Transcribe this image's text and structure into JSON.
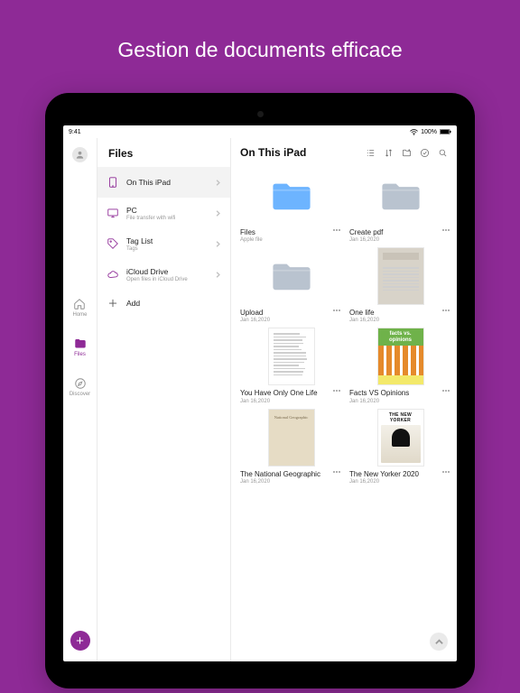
{
  "hero": "Gestion de documents efficace",
  "status": {
    "time": "9:41",
    "battery": "100%"
  },
  "rail": {
    "home": "Home",
    "files": "Files",
    "discover": "Discover"
  },
  "side": {
    "title": "Files",
    "locations": [
      {
        "title": "On This iPad",
        "sub": ""
      },
      {
        "title": "PC",
        "sub": "File transfer with wifi"
      },
      {
        "title": "Tag List",
        "sub": "Tags"
      },
      {
        "title": "iCloud Drive",
        "sub": "Open files in iCloud Drive"
      },
      {
        "title": "Add",
        "sub": ""
      }
    ]
  },
  "content": {
    "title": "On This iPad",
    "items": [
      {
        "title": "Files",
        "date": "Apple file",
        "kind": "folder",
        "color": "#6db4ff"
      },
      {
        "title": "Create pdf",
        "date": "Jan 16,2020",
        "kind": "folder",
        "color": "#b9c3cf"
      },
      {
        "title": "Upload",
        "date": "Jan 16,2020",
        "kind": "folder",
        "color": "#b9c3cf"
      },
      {
        "title": "One life",
        "date": "Jan 16,2020",
        "kind": "one-life"
      },
      {
        "title": "You Have Only One Life",
        "date": "Jan 16,2020",
        "kind": "text"
      },
      {
        "title": "Facts VS Opinions",
        "date": "Jan 16,2020",
        "kind": "facts",
        "hdr": "facts vs. opinions"
      },
      {
        "title": "The National Geographic",
        "date": "Jan 16,2020",
        "kind": "natgeo",
        "cover": "National Geographic"
      },
      {
        "title": "The New Yorker 2020",
        "date": "Jan 16,2020",
        "kind": "newyorker",
        "mast": "THE NEW YORKER"
      }
    ]
  }
}
